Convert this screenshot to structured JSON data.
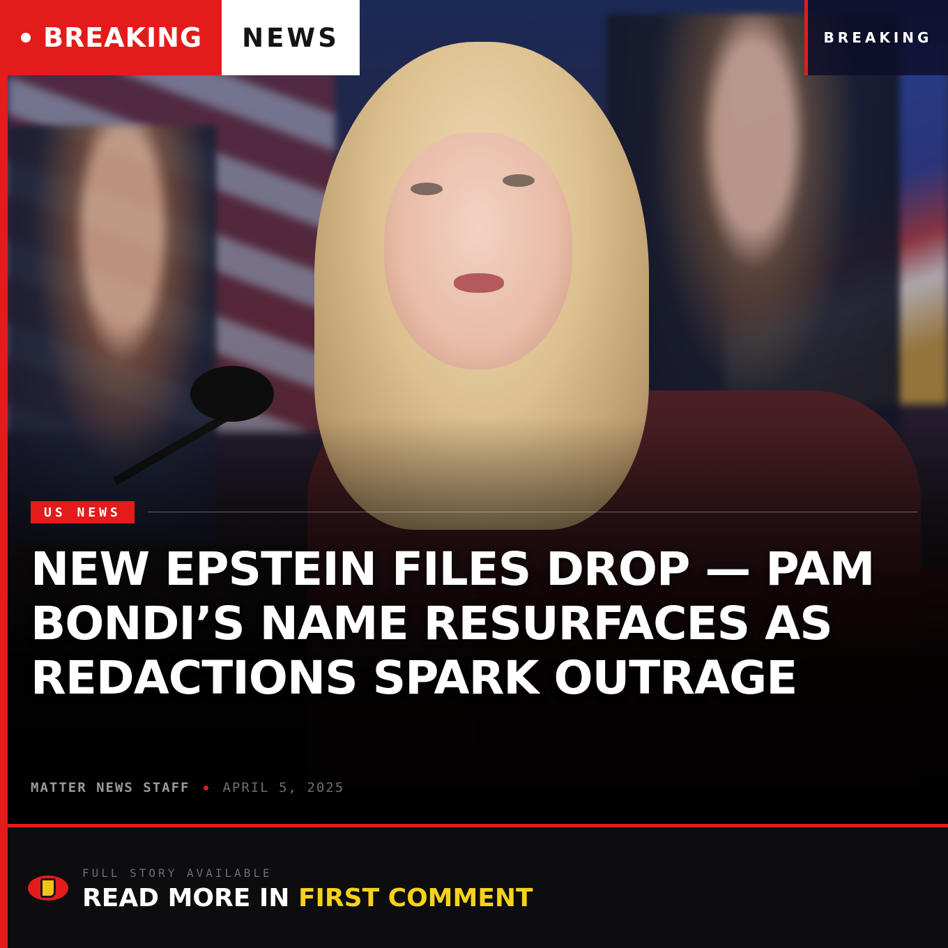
{
  "header": {
    "left_label": "BREAKING",
    "right_label": "NEWS",
    "corner_badge": "BREAKING"
  },
  "article": {
    "category": "US NEWS",
    "headline": "NEW EPSTEIN FILES DROP — PAM BONDI’S NAME RESURFACES AS REDACTIONS SPARK OUTRAGE",
    "author": "MATTER NEWS STAFF",
    "date": "APRIL 5, 2025"
  },
  "cta": {
    "kicker": "FULL STORY AVAILABLE",
    "text_white": "READ MORE IN",
    "text_highlight": "FIRST COMMENT",
    "icon": "pointing-hand-icon"
  },
  "colors": {
    "accent_red": "#e41b1b",
    "highlight_yellow": "#f6d21a",
    "background": "#0c0c0e"
  }
}
